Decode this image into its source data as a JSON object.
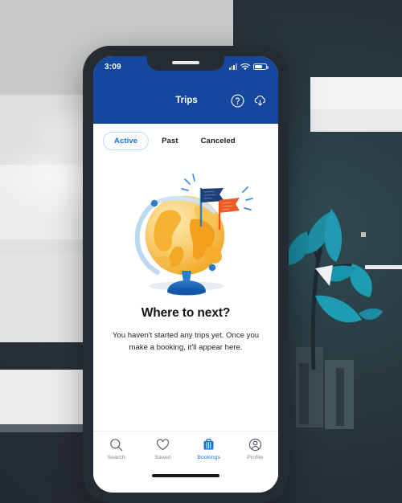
{
  "status_bar": {
    "time": "3:09",
    "icons": [
      "cellular-signal-icon",
      "wifi-icon",
      "battery-icon"
    ]
  },
  "nav": {
    "title": "Trips",
    "help_icon": "help-circle-icon",
    "download_icon": "cloud-download-icon",
    "background_color": "#16479f"
  },
  "tabs": {
    "items": [
      {
        "label": "Active",
        "active": true
      },
      {
        "label": "Past",
        "active": false
      },
      {
        "label": "Canceled",
        "active": false
      }
    ],
    "active_color": "#1673d4"
  },
  "empty_state": {
    "illustration": "globe-with-flags-illustration",
    "headline": "Where to next?",
    "body": "You haven't started any trips yet. Once you make a booking, it'll appear here."
  },
  "bottom_nav": {
    "items": [
      {
        "label": "Search",
        "icon": "search-icon",
        "active": false
      },
      {
        "label": "Saved",
        "icon": "heart-icon",
        "active": false
      },
      {
        "label": "Bookings",
        "icon": "suitcase-icon",
        "active": true
      },
      {
        "label": "Profile",
        "icon": "person-circle-icon",
        "active": false
      }
    ],
    "active_color": "#1673d4",
    "inactive_color": "#7b8287"
  },
  "colors": {
    "brand_blue": "#16479f",
    "accent_blue": "#1673d4",
    "globe_orange": "#f5a623",
    "flag_navy": "#1f3f77",
    "flag_orange": "#ef5a24",
    "leaf_teal": "#1f94a8",
    "phone_frame": "#252c31"
  }
}
